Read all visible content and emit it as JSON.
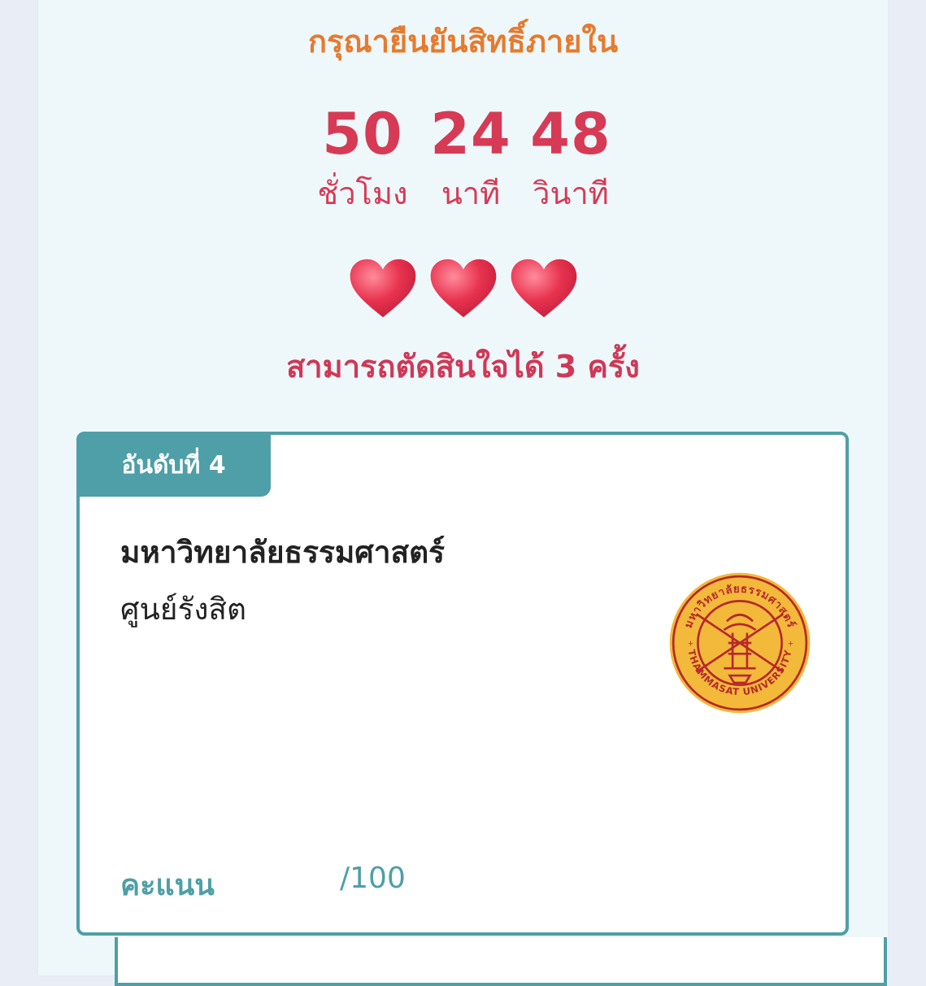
{
  "deadline_title": "กรุณายืนยันสิทธิ์ภายใน",
  "countdown": {
    "hours": "50",
    "hours_label": "ชั่วโมง",
    "minutes": "24",
    "minutes_label": "นาที",
    "seconds": "48",
    "seconds_label": "วินาที"
  },
  "attempts": {
    "remaining": 3,
    "text": "สามารถตัดสินใจได้ 3 ครั้ง"
  },
  "result_card": {
    "rank_label": "อันดับที่ 4",
    "university": "มหาวิทยาลัยธรรมศาสตร์",
    "campus": "ศูนย์รังสิต",
    "logo": "thammasat-seal",
    "logo_text": "มหาวิทยาลัยธรรมศาสตร์ • THAMMASAT UNIVERSITY",
    "score_label": "คะแนน",
    "score_max": "/100"
  },
  "colors": {
    "accent_orange": "#e67a2e",
    "timer_red": "#d63a55",
    "teal": "#4e9fa7",
    "heart": "#e8334f"
  }
}
